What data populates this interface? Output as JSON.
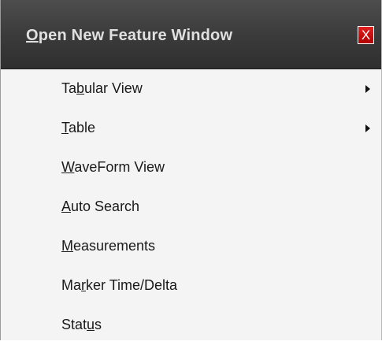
{
  "window": {
    "title_mnemonic": "O",
    "title_rest": "pen New Feature Window",
    "close_label": "X",
    "close_color": "#d01010",
    "title_bar_color": "#3a3a3a",
    "background_color": "#f4f4f4"
  },
  "menu": {
    "items": [
      {
        "pre": "Ta",
        "key": "b",
        "post": "ular View",
        "submenu": true
      },
      {
        "pre": "",
        "key": "T",
        "post": "able",
        "submenu": true
      },
      {
        "pre": "",
        "key": "W",
        "post": "aveForm View",
        "submenu": false
      },
      {
        "pre": "",
        "key": "A",
        "post": "uto Search",
        "submenu": false
      },
      {
        "pre": "",
        "key": "M",
        "post": "easurements",
        "submenu": false
      },
      {
        "pre": "Ma",
        "key": "r",
        "post": "ker Time/Delta",
        "submenu": false
      },
      {
        "pre": "Stat",
        "key": "u",
        "post": "s",
        "submenu": false
      }
    ],
    "submenu_arrow_icon": "triangle-right-icon"
  }
}
